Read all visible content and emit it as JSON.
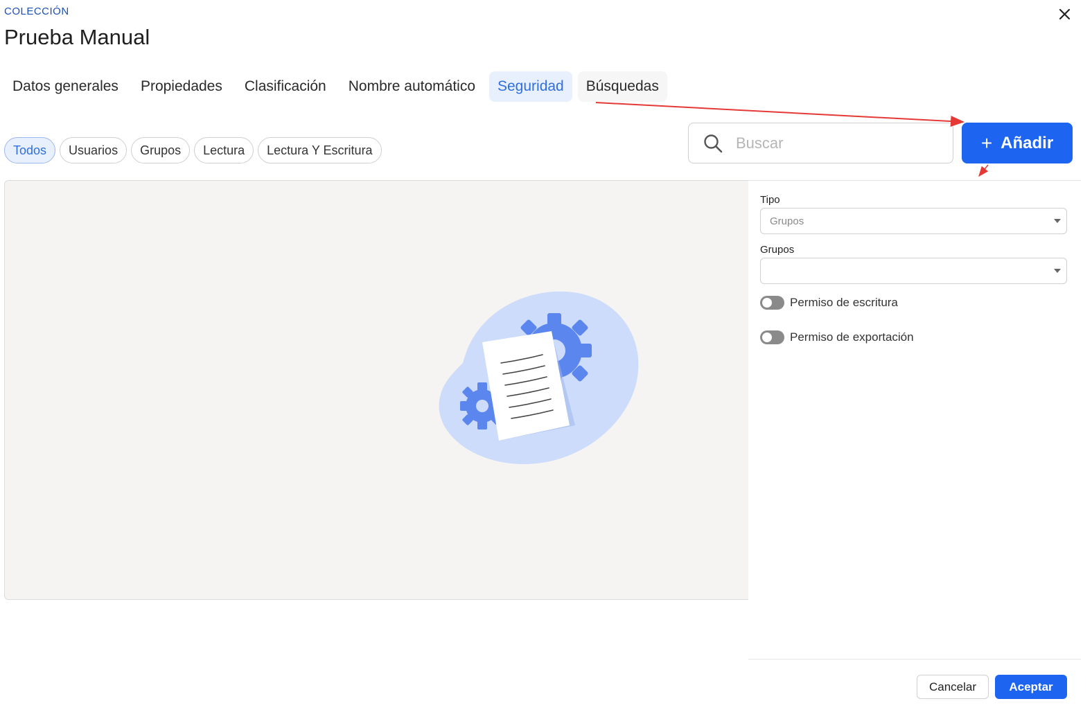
{
  "header": {
    "eyebrow": "COLECCIÓN",
    "title": "Prueba Manual",
    "close_icon": "close-icon"
  },
  "tabs": [
    {
      "label": "Datos generales",
      "active": false
    },
    {
      "label": "Propiedades",
      "active": false
    },
    {
      "label": "Clasificación",
      "active": false
    },
    {
      "label": "Nombre automático",
      "active": false
    },
    {
      "label": "Seguridad",
      "active": true
    },
    {
      "label": "Búsquedas",
      "active": false
    }
  ],
  "filters": [
    {
      "label": "Todos",
      "active": true
    },
    {
      "label": "Usuarios",
      "active": false
    },
    {
      "label": "Grupos",
      "active": false
    },
    {
      "label": "Lectura",
      "active": false
    },
    {
      "label": "Lectura Y Escritura",
      "active": false
    }
  ],
  "search": {
    "placeholder": "Buscar",
    "value": "",
    "icon": "search-icon"
  },
  "add_button": {
    "label": "Añadir",
    "icon": "plus-icon"
  },
  "empty_state": {
    "icon": "document-gears-illustration"
  },
  "form": {
    "tipo": {
      "label": "Tipo",
      "value": "Grupos"
    },
    "grupos": {
      "label": "Grupos",
      "value": ""
    },
    "write_permission": {
      "label": "Permiso de escritura",
      "enabled": false
    },
    "export_permission": {
      "label": "Permiso de exportación",
      "enabled": false
    }
  },
  "footer": {
    "cancel_label": "Cancelar",
    "accept_label": "Aceptar"
  },
  "colors": {
    "accent": "#1d64f0",
    "active_tab_bg": "#e9f0fd",
    "active_tab_text": "#2f6fe0",
    "annotation_arrow": "#e53935",
    "empty_bg": "#f5f4f3"
  }
}
